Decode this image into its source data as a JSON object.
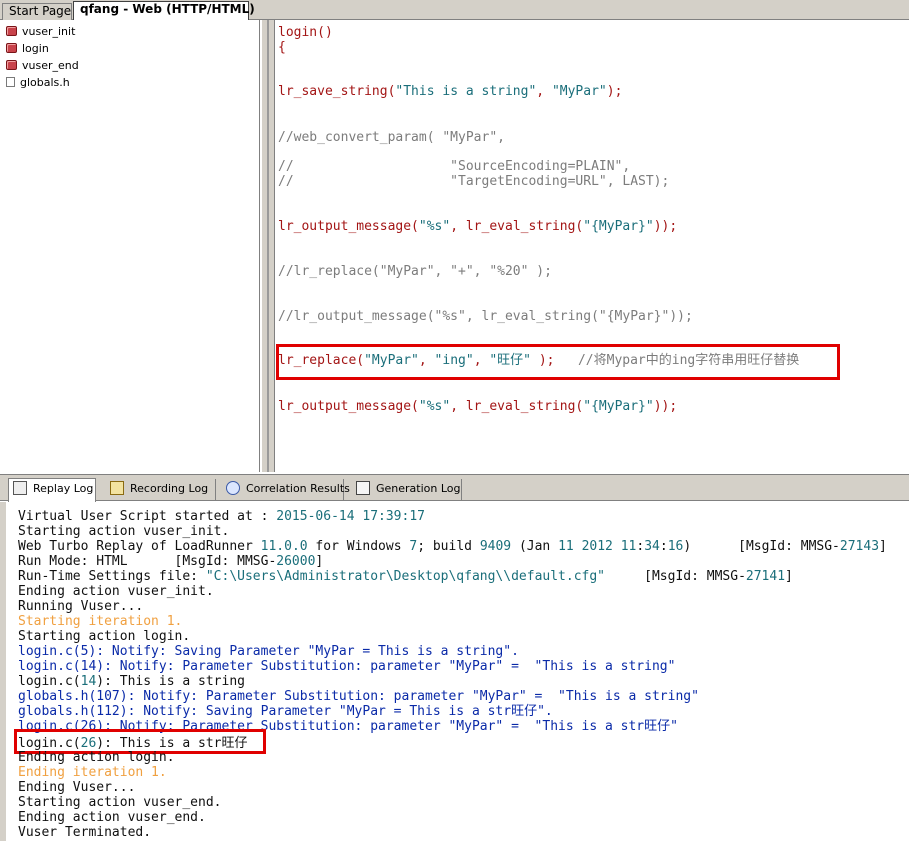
{
  "document_tabs": [
    {
      "label": "Start Page"
    },
    {
      "label": "qfang - Web (HTTP/HTML)"
    }
  ],
  "tree": {
    "items": [
      {
        "label": "vuser_init",
        "icon": "action-icon"
      },
      {
        "label": "login",
        "icon": "action-icon"
      },
      {
        "label": "vuser_end",
        "icon": "action-icon"
      },
      {
        "label": "globals.h",
        "icon": "header-file-icon"
      }
    ]
  },
  "code": {
    "l1": "login()",
    "l2": "{",
    "save_fn": "lr_save_string(",
    "save_str": "\"This is a string\"",
    "save_sep": ", ",
    "save_name": "\"MyPar\"",
    "save_end": ");",
    "c1": "//web_convert_param( \"MyPar\",",
    "c2": "//                    \"SourceEncoding=PLAIN\",",
    "c3": "//                    \"TargetEncoding=URL\", LAST);",
    "out1_fn": "lr_output_message(",
    "out1_fmt": "\"%s\"",
    "out1_mid": ", lr_eval_string(",
    "out1_arg": "\"{MyPar}\"",
    "out1_end": "));",
    "c4": "//lr_replace(\"MyPar\", \"+\", \"%20\" );",
    "c5": "//lr_output_message(\"%s\", lr_eval_string(\"{MyPar}\"));",
    "rep_fn": "lr_replace(",
    "rep_a": "\"MyPar\"",
    "rep_s1": ", ",
    "rep_b": "\"ing\"",
    "rep_s2": ", ",
    "rep_c": "\"旺仔\"",
    "rep_end": " );",
    "rep_cmt": "   //将Mypar中的ing字符串用旺仔替换",
    "out2_fn": "lr_output_message(",
    "out2_fmt": "\"%s\"",
    "out2_mid": ", lr_eval_string(",
    "out2_arg": "\"{MyPar}\"",
    "out2_end": "));"
  },
  "log_tabs": [
    {
      "label": "Replay Log",
      "icon": "replay-log-icon"
    },
    {
      "label": "Recording Log",
      "icon": "recording-log-icon"
    },
    {
      "label": "Correlation Results",
      "icon": "correlation-icon"
    },
    {
      "label": "Generation Log",
      "icon": "generation-log-icon"
    }
  ],
  "log": {
    "r1a": "Virtual User Script started at : ",
    "r1b": "2015-06-14 17:39:17",
    "r2": "Starting action vuser_init.",
    "r3a": "Web Turbo Replay of LoadRunner ",
    "r3b": "11.0.0",
    "r3c": " for Windows ",
    "r3d": "7",
    "r3e": "; build ",
    "r3f": "9409",
    "r3g": " (Jan ",
    "r3h": "11 2012 11",
    "r3i": ":",
    "r3j": "34",
    "r3k": ":",
    "r3l": "16",
    "r3m": ")      [MsgId: MMSG-",
    "r3n": "27143",
    "r3o": "]",
    "r4a": "Run Mode: HTML      [MsgId: MMSG-",
    "r4b": "26000",
    "r4c": "]",
    "r5a": "Run-Time Settings file: ",
    "r5b": "\"C:\\Users\\Administrator\\Desktop\\qfang\\\\default.cfg\"",
    "r5c": "     [MsgId: MMSG-",
    "r5d": "27141",
    "r5e": "]",
    "r6": "Ending action vuser_init.",
    "r7": "Running Vuser...",
    "r8": "Starting iteration 1.",
    "r9": "Starting action login.",
    "r10": "login.c(5): Notify: Saving Parameter \"MyPar = This is a string\".",
    "r11": "login.c(14): Notify: Parameter Substitution: parameter \"MyPar\" =  \"This is a string\"",
    "r12a": "login.c(",
    "r12b": "14",
    "r12c": "): This is a string",
    "r13": "globals.h(107): Notify: Parameter Substitution: parameter \"MyPar\" =  \"This is a string\"",
    "r14": "globals.h(112): Notify: Saving Parameter \"MyPar = This is a str旺仔\".",
    "r15": "login.c(26): Notify: Parameter Substitution: parameter \"MyPar\" =  \"This is a str旺仔\"",
    "r16a": "login.c(",
    "r16b": "26",
    "r16c": "): This is a str旺仔",
    "r17": "Ending action login.",
    "r18": "Ending iteration 1.",
    "r19": "Ending Vuser...",
    "r20": "Starting action vuser_end.",
    "r21": "Ending action vuser_end.",
    "r22": "Vuser Terminated."
  },
  "colors": {
    "highlight": "#e00000",
    "log_blue": "#0a2aa8",
    "log_orange": "#f0a040",
    "string_teal": "#1a6e7a"
  }
}
